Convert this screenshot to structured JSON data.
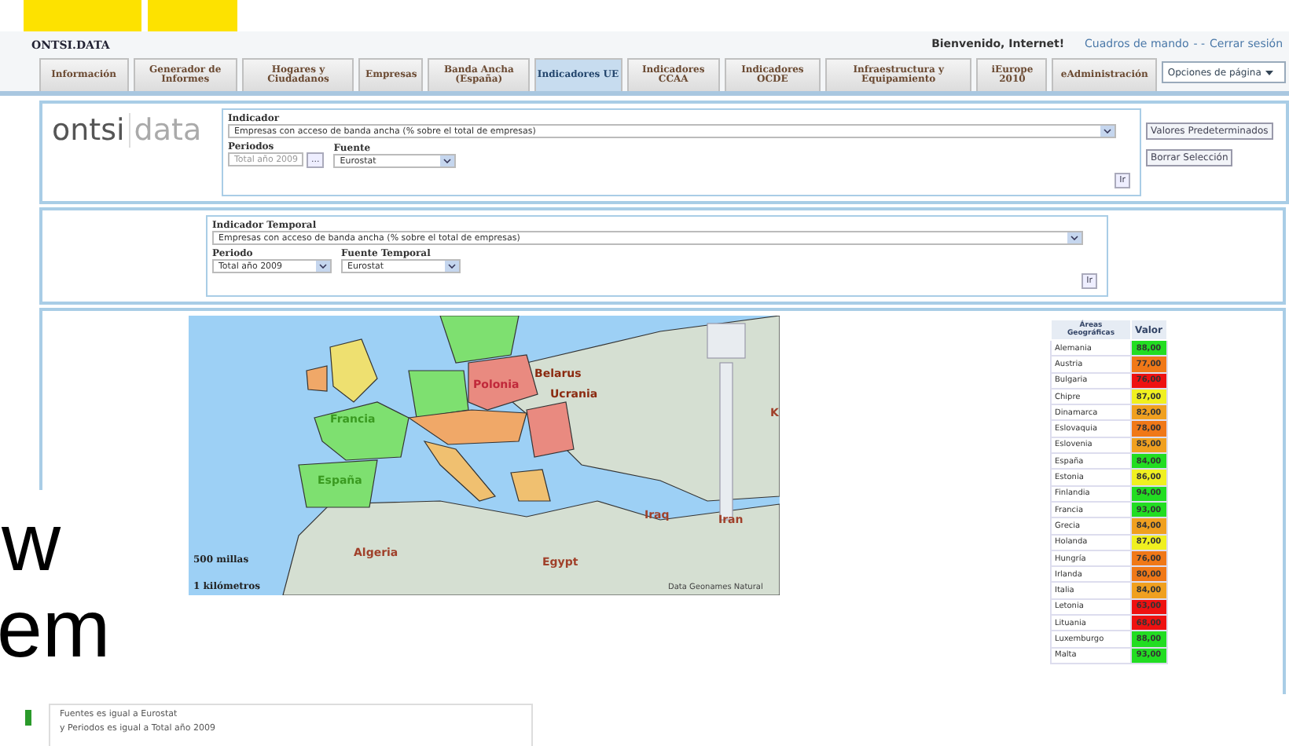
{
  "header": {
    "brand": "ONTSI.DATA",
    "welcome": "Bienvenido, Internet!",
    "links": [
      "Cuadros de mando",
      "- -",
      "Cerrar sesión"
    ]
  },
  "tabs": [
    {
      "label": "Información",
      "selected": false
    },
    {
      "label": "Generador de Informes",
      "selected": false
    },
    {
      "label": "Hogares y Ciudadanos",
      "selected": false
    },
    {
      "label": "Empresas",
      "selected": false
    },
    {
      "label": "Banda Ancha (España)",
      "selected": false
    },
    {
      "label": "Indicadores UE",
      "selected": true
    },
    {
      "label": "Indicadores CCAA",
      "selected": false
    },
    {
      "label": "Indicadores OCDE",
      "selected": false
    },
    {
      "label": "Infraestructura y Equipamiento",
      "selected": false
    },
    {
      "label": "iEurope 2010",
      "selected": false
    },
    {
      "label": "eAdministración",
      "selected": false
    }
  ],
  "page_options": "Opciones de página",
  "filters": {
    "logo": [
      "ontsi",
      "data"
    ],
    "indicator_label": "Indicador",
    "indicator": "Empresas con acceso de banda ancha (% sobre el total de empresas)",
    "periods_label": "Periodos",
    "periods": "Total año 2009",
    "browse": "...",
    "source_label": "Fuente",
    "source": "Eurostat",
    "go": "Ir",
    "buttons": [
      "Valores Predeterminados",
      "Borrar Selección"
    ]
  },
  "temporal": {
    "indicator_label": "Indicador Temporal",
    "indicator": "Empresas con acceso de banda ancha (% sobre el total de empresas)",
    "period_label": "Periodo",
    "period": "Total año 2009",
    "source_label": "Fuente Temporal",
    "source": "Eurostat",
    "go": "Ir"
  },
  "map": {
    "labels": [
      "Polonia",
      "Belarus",
      "Ucrania",
      "Francia",
      "España",
      "Iraq",
      "Iran",
      "Algeria",
      "Egypt",
      "K"
    ],
    "scale": [
      "500 millas",
      "1 kilómetros"
    ],
    "credit": "Data Geonames Natural"
  },
  "table": {
    "columns": [
      "Áreas Geográficas",
      "Valor"
    ],
    "rows": [
      {
        "area": "Alemania",
        "value": "88,00",
        "color": "#22dd22"
      },
      {
        "area": "Austria",
        "value": "77,00",
        "color": "#f07818"
      },
      {
        "area": "Bulgaria",
        "value": "76,00",
        "color": "#ee1111"
      },
      {
        "area": "Chipre",
        "value": "87,00",
        "color": "#f0f020"
      },
      {
        "area": "Dinamarca",
        "value": "82,00",
        "color": "#f0a020"
      },
      {
        "area": "Eslovaquia",
        "value": "78,00",
        "color": "#f07818"
      },
      {
        "area": "Eslovenia",
        "value": "85,00",
        "color": "#f0a020"
      },
      {
        "area": "España",
        "value": "84,00",
        "color": "#22dd22"
      },
      {
        "area": "Estonia",
        "value": "86,00",
        "color": "#f0f020"
      },
      {
        "area": "Finlandia",
        "value": "94,00",
        "color": "#22dd22"
      },
      {
        "area": "Francia",
        "value": "93,00",
        "color": "#22dd22"
      },
      {
        "area": "Grecia",
        "value": "84,00",
        "color": "#f0a020"
      },
      {
        "area": "Holanda",
        "value": "87,00",
        "color": "#f0f020"
      },
      {
        "area": "Hungría",
        "value": "76,00",
        "color": "#f07818"
      },
      {
        "area": "Irlanda",
        "value": "80,00",
        "color": "#f07818"
      },
      {
        "area": "Italia",
        "value": "84,00",
        "color": "#f0a020"
      },
      {
        "area": "Letonia",
        "value": "63,00",
        "color": "#ee1111"
      },
      {
        "area": "Lituania",
        "value": "68,00",
        "color": "#ee1111"
      },
      {
        "area": "Luxemburgo",
        "value": "88,00",
        "color": "#22dd22"
      },
      {
        "area": "Malta",
        "value": "93,00",
        "color": "#22dd22"
      }
    ]
  },
  "slide_text": [
    "w",
    "em"
  ],
  "summary": [
    "Fuentes es igual a Eurostat",
    "y Periodos es igual a Total año 2009"
  ]
}
